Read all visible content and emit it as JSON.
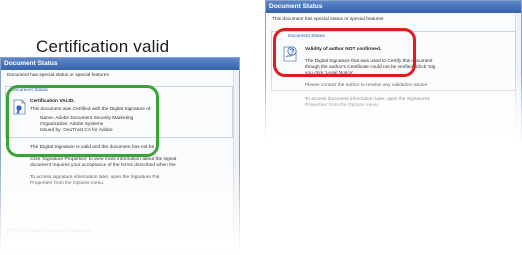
{
  "caption": "Certification valid",
  "left_window": {
    "title": "Document Status",
    "intro": "Document has special status or special features",
    "section_label": "Document Status",
    "cert_title": "Certification VALID.",
    "cert_desc": "This document was Certified with the Digital Signature of:",
    "name_line": "Name: Adobe Document Security Marketing",
    "org_line": "Organization: Adobe Systems",
    "issuer_line": "Issued by: GeoTrust CA for Adobe",
    "valid_line": "The Digital Signature is valid and the document has not be",
    "props_line1": "Click 'Signature Properties' to view more information about the signat",
    "props_line2": "document requires your acceptance of the terms described when the",
    "info_line1": "To access signature information later, open the Signature Pal",
    "info_line2": "Properties' from the Options menu.",
    "checkbox_label": "Do not show Document Status again"
  },
  "right_window": {
    "title": "Document Status",
    "intro": "This document has special status or special features",
    "section_label": "Document Status",
    "validity_title": "Validity of author NOT confirmed.",
    "sig_line1": "The Digital Signature that was used to Certify this document",
    "sig_line2": "though the author's Certificate could not be verified. Click 'Sig",
    "sig_line3": "you click 'Legal Notice'.",
    "contact_line": "Please contact the author to resolve any validation issues",
    "access_line1": "To access document information later, open the Signatures",
    "access_line2": "Properties' from the Options menu."
  },
  "colors": {
    "green_highlight": "#3aa335",
    "red_highlight": "#e01b1b",
    "titlebar": "#3563ad"
  },
  "icons": {
    "certified_document": "certified-document-icon",
    "unverified_signature": "question-signature-icon"
  }
}
